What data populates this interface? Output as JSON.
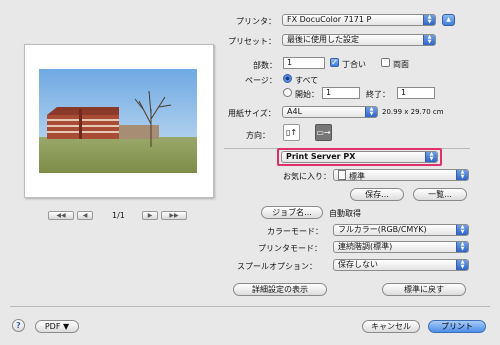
{
  "header": {
    "printer_label": "プリンタ：",
    "printer_value": "FX DocuColor 7171 P",
    "preset_label": "プリセット：",
    "preset_value": "最後に使用した設定"
  },
  "copies": {
    "copies_label": "部数：",
    "copies_value": "1",
    "collate_label": "丁合い",
    "collate_checked": true,
    "duplex_label": "両面",
    "duplex_checked": false
  },
  "pages": {
    "label": "ページ：",
    "all_label": "すべて",
    "from_label": "開始：",
    "from_value": "1",
    "to_label": "終了：",
    "to_value": "1"
  },
  "paper": {
    "label": "用紙サイズ：",
    "value": "A4L",
    "dimensions": "20.99 x 29.70 cm",
    "orientation_label": "方向："
  },
  "panel": {
    "value": "Print Server PX",
    "highlight_color": "#e0306a"
  },
  "favorites": {
    "label": "お気に入り：",
    "value": "標準",
    "save_button": "保存...",
    "list_button": "一覧..."
  },
  "preview": {
    "page_indicator": "1/1",
    "prev_icon": "◀◀ ◀",
    "next_icon": "▶ ▶▶"
  },
  "job": {
    "job_name_button": "ジョブ名...",
    "auto_get": "自動取得",
    "color_mode_label": "カラーモード：",
    "color_mode_value": "フルカラー(RGB/CMYK)",
    "printer_mode_label": "プリンタモード：",
    "printer_mode_value": "連続階調(標準)",
    "spool_label": "スプールオプション：",
    "spool_value": "保存しない",
    "details_button": "詳細設定の表示",
    "defaults_button": "標準に戻す"
  },
  "footer": {
    "help": "?",
    "pdf_button": "PDF ▼",
    "cancel_button": "キャンセル",
    "print_button": "プリント"
  }
}
